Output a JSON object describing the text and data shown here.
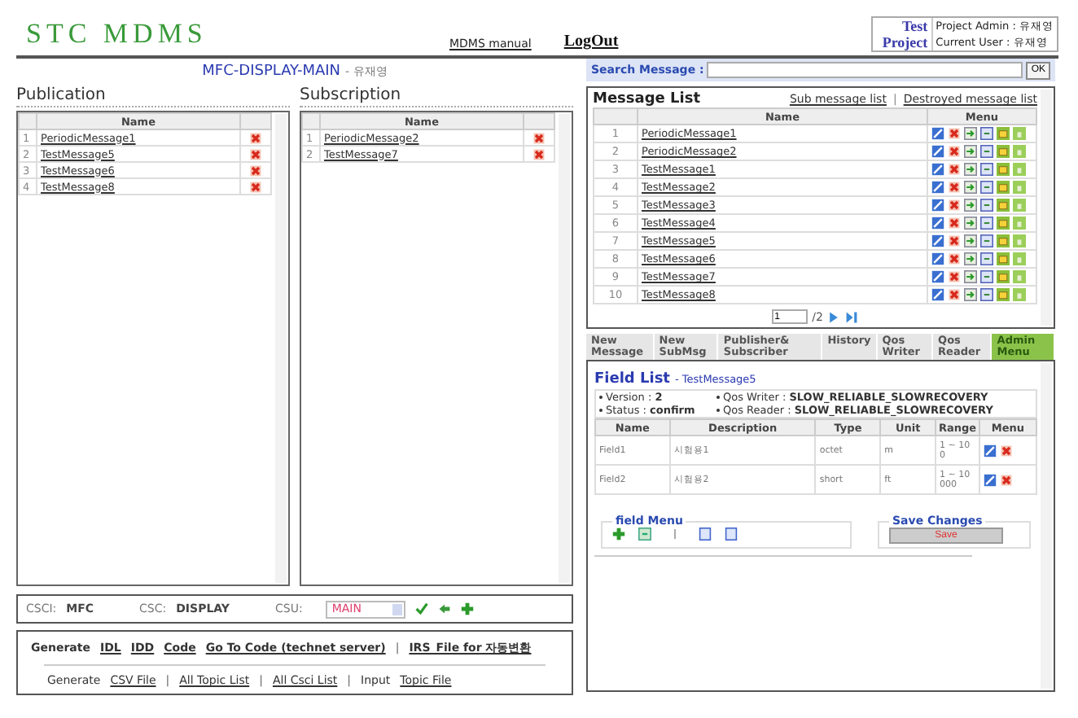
{
  "header": {
    "logo": "STC MDMS",
    "links": [
      "MDMS manual",
      "LogOut"
    ],
    "project": "Test Project",
    "admin": "Project Admin : 유재영",
    "user": "Current User  : 유재영"
  },
  "title": {
    "name": "MFC-DISPLAY-MAIN",
    "owner": "- 유재영"
  },
  "publication": {
    "heading": "Publication",
    "column": "Name",
    "rows": [
      {
        "num": "1",
        "name": "PeriodicMessage1"
      },
      {
        "num": "2",
        "name": "TestMessage5"
      },
      {
        "num": "3",
        "name": "TestMessage6"
      },
      {
        "num": "4",
        "name": "TestMessage8"
      }
    ]
  },
  "subscription": {
    "heading": "Subscription",
    "column": "Name",
    "rows": [
      {
        "num": "1",
        "name": "PeriodicMessage2"
      },
      {
        "num": "2",
        "name": "TestMessage7"
      }
    ]
  },
  "csci_bar": {
    "items": [
      {
        "label": "CSCI:",
        "value": "MFC"
      },
      {
        "label": "CSC:",
        "value": "DISPLAY"
      }
    ],
    "csu_label": "CSU:",
    "csu_value": "MAIN"
  },
  "generate": [
    [
      {
        "kind": "text",
        "text": "Generate"
      },
      {
        "kind": "link",
        "text": "IDL"
      },
      {
        "kind": "link",
        "text": "IDD"
      },
      {
        "kind": "link",
        "text": "Code"
      },
      {
        "kind": "link",
        "text": "Go To Code (technet server)"
      },
      {
        "kind": "sep",
        "text": "|"
      },
      {
        "kind": "link",
        "text": "IRS_File for 자동변환"
      }
    ],
    [
      {
        "kind": "text",
        "text": "Generate"
      },
      {
        "kind": "link",
        "text": "CSV File"
      },
      {
        "kind": "sep",
        "text": "|"
      },
      {
        "kind": "link",
        "text": "All Topic List"
      },
      {
        "kind": "sep",
        "text": "|"
      },
      {
        "kind": "link",
        "text": "All Csci List"
      },
      {
        "kind": "sep",
        "text": "|"
      },
      {
        "kind": "text",
        "text": "Input"
      },
      {
        "kind": "link",
        "text": "Topic File"
      }
    ]
  ],
  "search": {
    "label": "Search Message :",
    "button": "OK"
  },
  "message_list": {
    "title": "Message List",
    "links": [
      "Sub message list",
      "Destroyed message list"
    ],
    "separator": "|",
    "columns": [
      "Name",
      "Menu"
    ],
    "rows": [
      {
        "num": "1",
        "name": "PeriodicMessage1"
      },
      {
        "num": "2",
        "name": "PeriodicMessage2"
      },
      {
        "num": "3",
        "name": "TestMessage1"
      },
      {
        "num": "4",
        "name": "TestMessage2"
      },
      {
        "num": "5",
        "name": "TestMessage3"
      },
      {
        "num": "6",
        "name": "TestMessage4"
      },
      {
        "num": "7",
        "name": "TestMessage5"
      },
      {
        "num": "8",
        "name": "TestMessage6"
      },
      {
        "num": "9",
        "name": "TestMessage7"
      },
      {
        "num": "10",
        "name": "TestMessage8"
      }
    ],
    "pager": {
      "page": "1",
      "total": "/2"
    }
  },
  "tabs": [
    {
      "label": "New Message",
      "selected": false
    },
    {
      "label": "New SubMsg",
      "selected": false
    },
    {
      "label": "Publisher& Subscriber",
      "selected": false
    },
    {
      "label": "History",
      "selected": false
    },
    {
      "label": "Qos Writer",
      "selected": false
    },
    {
      "label": "Qos Reader",
      "selected": false
    },
    {
      "label": "Admin Menu",
      "selected": true
    }
  ],
  "field_list": {
    "title": "Field List",
    "message": "- TestMessage5",
    "info": [
      "Version : **2**",
      "Qos Writer   : **SLOW_RELIABLE_SLOWRECOVERY**",
      "Status : **confirm**",
      "Qos Reader : **SLOW_RELIABLE_SLOWRECOVERY**"
    ],
    "columns": [
      "Name",
      "Description",
      "Type",
      "Unit",
      "Range",
      "Menu"
    ],
    "rows": [
      {
        "name": "Field1",
        "description": "시험용1",
        "type": "octet",
        "unit": "m",
        "range": "1 ~ 100"
      },
      {
        "name": "Field2",
        "description": "시험용2",
        "type": "short",
        "unit": "ft",
        "range": "1 ~ 10000"
      }
    ],
    "field_menu": "field Menu",
    "save_legend": "Save Changes",
    "save_button": "Save"
  }
}
